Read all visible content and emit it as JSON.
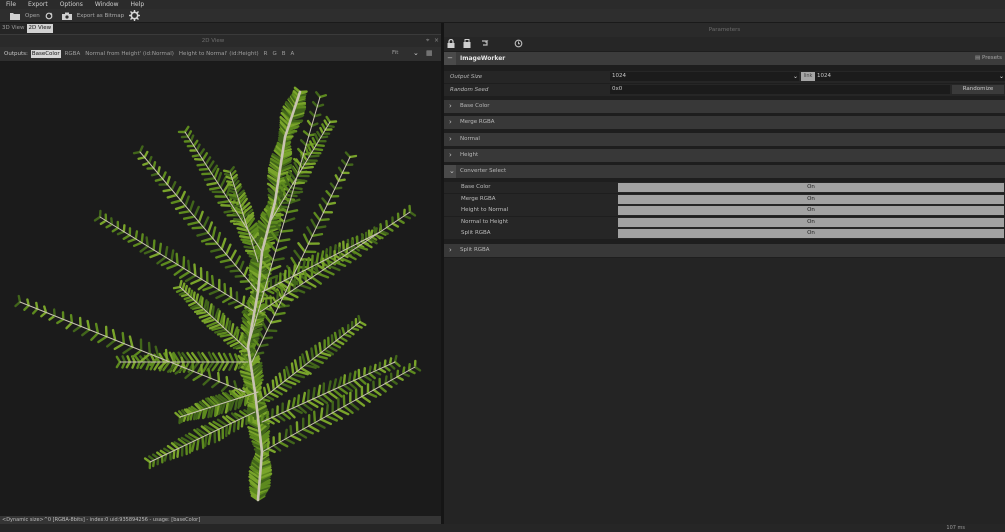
{
  "menu": [
    "File",
    "Export",
    "Options",
    "Window",
    "Help"
  ],
  "toolbar": {
    "open_label": "Open",
    "export_label": "Export as Bitmap"
  },
  "left_tabs": [
    "3D View",
    "2D View"
  ],
  "left_panel": {
    "title": "2D View",
    "outputs_label": "Outputs:",
    "outputs": [
      "BaseColor",
      "RGBA",
      "Normal from Height' (id:Normal)",
      "Height to Normal' (id:Height)",
      "R",
      "G",
      "B",
      "A"
    ],
    "active_output": "BaseColor",
    "fit_label": "Fit"
  },
  "status_text": "<Dynamic size>^0 [RGBA-8bits] - index:0 uid:935894256 - usage: [baseColor]",
  "timing": "107 ms",
  "parameters": {
    "title": "Parameters",
    "worker_name": "ImageWorker",
    "presets_label": "Presets",
    "output_size_label": "Output Size",
    "output_size_w": "1024",
    "output_size_h": "1024",
    "link_label": "link",
    "random_seed_label": "Random Seed",
    "random_seed_value": "0x0",
    "randomize_label": "Randomize",
    "sections_before": [
      "Base Color",
      "Merge RGBA",
      "Normal",
      "Height"
    ],
    "converter_section": "Converter Select",
    "converter_rows": [
      {
        "label": "Base Color",
        "value": "On"
      },
      {
        "label": "Merge RGBA",
        "value": "On"
      },
      {
        "label": "Height to Normal",
        "value": "On"
      },
      {
        "label": "Normal to Height",
        "value": "On"
      },
      {
        "label": "Split RGBA",
        "value": "On"
      }
    ],
    "section_after": "Split RGBA"
  },
  "colors": {
    "accent_on": "#a2a2a2",
    "panel": "#262626",
    "section": "#383838",
    "leaf": "#5d8a1e"
  },
  "icons": [
    "folder-icon",
    "refresh-icon",
    "camera-icon",
    "gear-icon",
    "lock-icon",
    "save-icon",
    "reset-icon",
    "history-icon",
    "presets-icon",
    "grid-icon"
  ]
}
